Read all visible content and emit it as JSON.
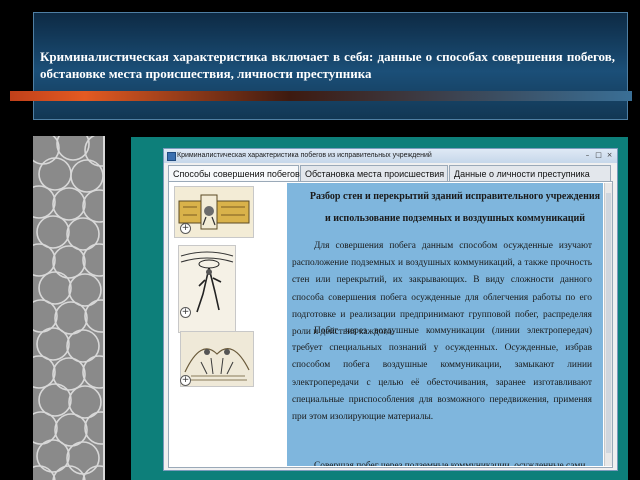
{
  "slide": {
    "banner_text": "Криминалистическая характеристика включает в себя: данные о способах совершения побегов, обстановке места происшествия, личности преступника"
  },
  "window": {
    "title": "Криминалистическая характеристика побегов из исправительных учреждений",
    "controls": {
      "minimize": "–",
      "maximize": "□",
      "close": "×"
    }
  },
  "tabs": [
    {
      "label": "Способы совершения побегов",
      "active": true
    },
    {
      "label": "Обстановка места происшествия",
      "active": false
    },
    {
      "label": "Данные о личности преступника",
      "active": false
    }
  ],
  "article": {
    "heading": "Разбор стен и перекрытий зданий исправительного учреждения и использование подземных и воздушных коммуникаций",
    "paragraphs": [
      "Для совершения побега данным способом осужденные изучают расположение подземных и воздушных коммуникаций, а также прочность стен или перекрытий, их закрывающих. В виду сложности данного способа совершения побега осужденные для облегчения работы по его подготовке и реализации предпринимают групповой побег, распределяя роли и действия каждого.",
      "Побег через воздушные коммуникации (линии электропередач) требует специальных познаний у осужденных. Осужденные, избрав способом побега воздушные коммуникации, замыкают линии электропередачи с целью её обесточивания, заранее изготавливают специальные приспособления для возможного передвижения, применяя при этом изолирующие материалы.",
      "Совершая побег через подземные коммуникации, осужденные сами"
    ]
  },
  "thumbnails": [
    {
      "icon": "zoom-icon",
      "zoom_glyph": "+"
    },
    {
      "icon": "zoom-icon",
      "zoom_glyph": "+"
    },
    {
      "icon": "zoom-icon",
      "zoom_glyph": "+"
    }
  ],
  "colors": {
    "pane_background": "#7fb6dd",
    "frame_teal": "#0d7f7a",
    "banner_blue": "#1b4f78"
  }
}
